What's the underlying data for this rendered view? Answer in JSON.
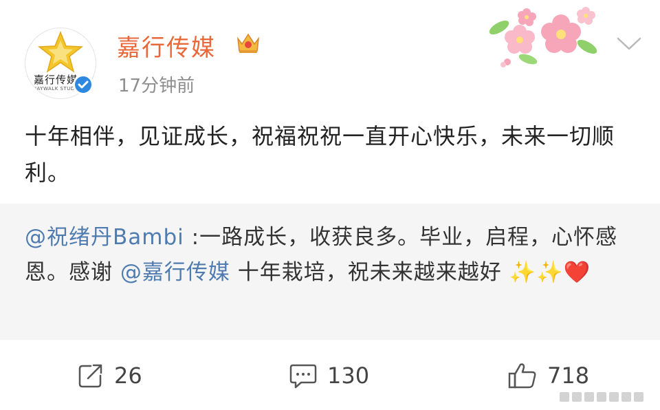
{
  "header": {
    "avatar_brand_cn": "嘉行传媒",
    "avatar_brand_en": "JAYWALK STUDIO",
    "username": "嘉行传媒",
    "time": "17分钟前",
    "verified_color": "#2f88e0",
    "username_color": "#e8683a"
  },
  "post": {
    "text": "十年相伴，见证成长，祝福祝祝一直开心快乐，未来一切顺利。"
  },
  "repost": {
    "mention_1": "@祝绪丹Bambi",
    "text_1": " :一路成长，收获良多。毕业，启程，心怀感恩。感谢 ",
    "mention_2": "@嘉行传媒",
    "text_2": " 十年栽培，祝未来越来越好 ",
    "emoji_sparkles": "✨✨",
    "emoji_heart": "❤️",
    "mention_color": "#4e7bb0"
  },
  "actions": {
    "repost_count": "26",
    "comment_count": "130",
    "like_count": "718"
  }
}
